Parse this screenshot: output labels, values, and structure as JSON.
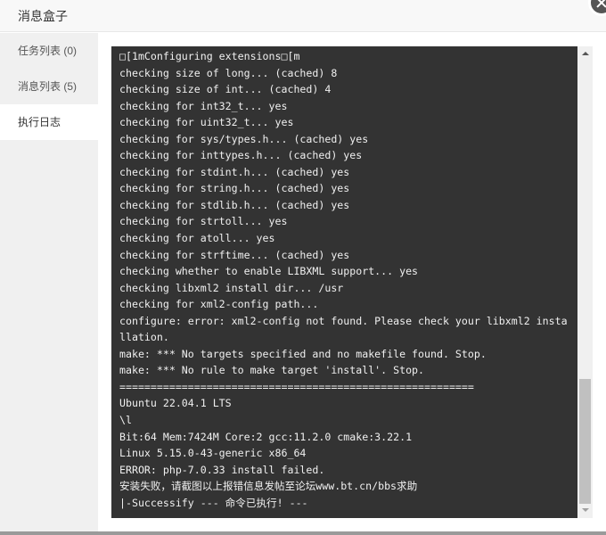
{
  "header": {
    "title": "消息盒子",
    "close_icon": "close-icon"
  },
  "sidebar": {
    "tabs": [
      {
        "label": "任务列表 (0)",
        "active": false
      },
      {
        "label": "消息列表 (5)",
        "active": false
      },
      {
        "label": "执行日志",
        "active": true
      }
    ]
  },
  "log": {
    "lines": [
      "\u001b[1mConfiguring extensions\u001b[m",
      "checking size of long... (cached) 8",
      "checking size of int... (cached) 4",
      "checking for int32_t... yes",
      "checking for uint32_t... yes",
      "checking for sys/types.h... (cached) yes",
      "checking for inttypes.h... (cached) yes",
      "checking for stdint.h... (cached) yes",
      "checking for string.h... (cached) yes",
      "checking for stdlib.h... (cached) yes",
      "checking for strtoll... yes",
      "checking for atoll... yes",
      "checking for strftime... (cached) yes",
      "checking whether to enable LIBXML support... yes",
      "checking libxml2 install dir... /usr",
      "checking for xml2-config path...",
      "configure: error: xml2-config not found. Please check your libxml2 installation.",
      "make: *** No targets specified and no makefile found. Stop.",
      "make: *** No rule to make target 'install'. Stop.",
      "=========================================================",
      "Ubuntu 22.04.1 LTS",
      "\\l",
      "Bit:64 Mem:7424M Core:2 gcc:11.2.0 cmake:3.22.1",
      "Linux 5.15.0-43-generic x86_64",
      "ERROR: php-7.0.33 install failed.",
      "安装失败，请截图以上报错信息发帖至论坛www.bt.cn/bbs求助",
      "|-Successify --- 命令已执行! ---"
    ]
  },
  "scrollbar": {
    "up_icon": "scroll-up-arrow-icon",
    "down_icon": "scroll-down-arrow-icon",
    "scroll_position": 1.0
  },
  "colors": {
    "terminal_bg": "#333333",
    "terminal_fg": "#f0f0f0",
    "sidebar_bg": "#f0f0f0",
    "header_bg": "#f8f8f8"
  }
}
